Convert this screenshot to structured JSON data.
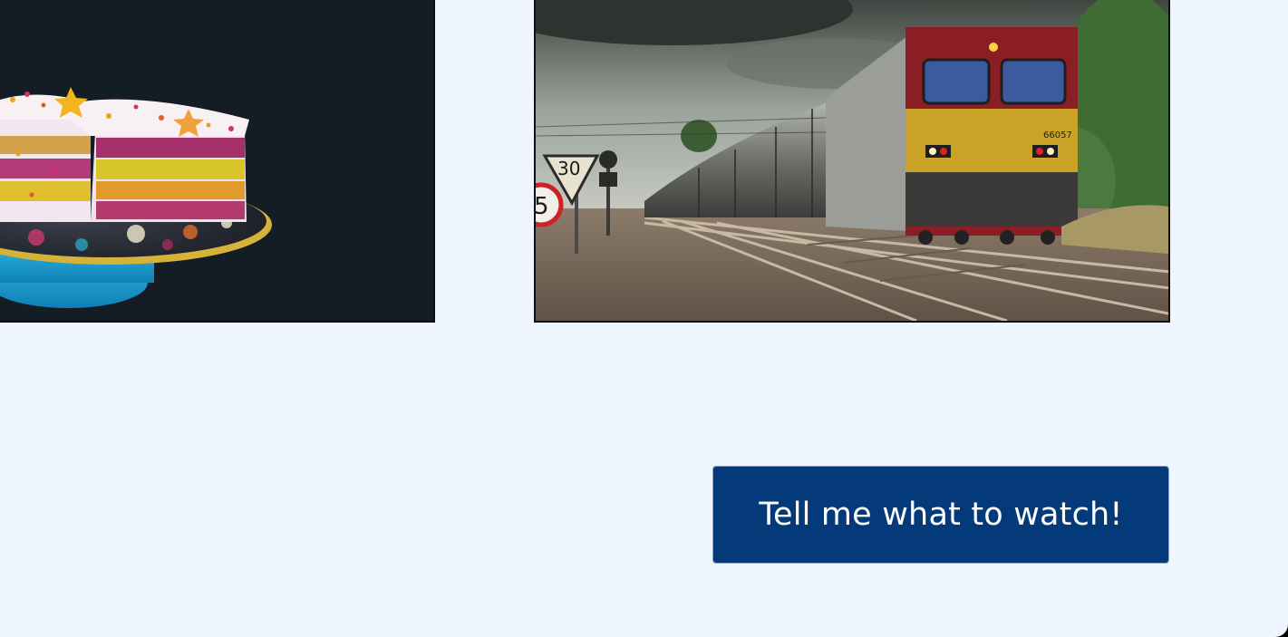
{
  "images": {
    "left": {
      "alt": "Layered rainbow cake with sprinkles and star toppers on a cake stand"
    },
    "right": {
      "alt": "Freight locomotive pulling tanker cars along railway tracks",
      "signs": [
        "30",
        "5"
      ],
      "loco_number": "66057"
    }
  },
  "cta": {
    "label": "Tell me what to watch!"
  },
  "colors": {
    "page_background": "#eff6ff",
    "button_background": "#043a7a",
    "button_text": "#ffffff"
  }
}
